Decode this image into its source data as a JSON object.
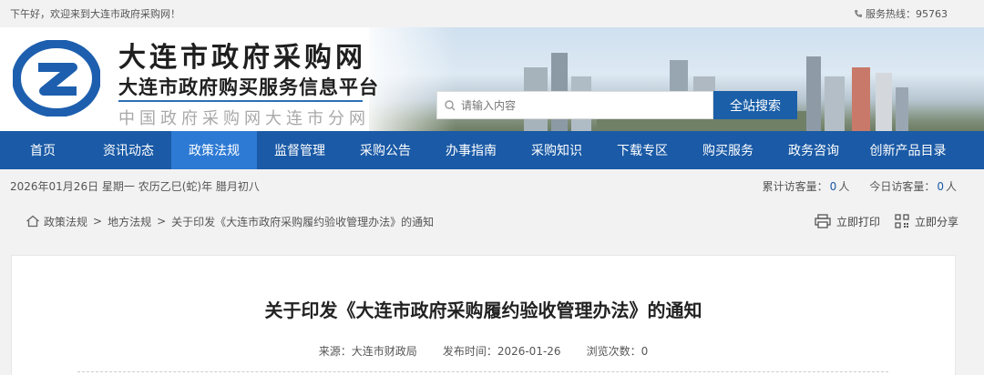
{
  "topbar": {
    "greeting": "下午好，欢迎来到大连市政府采购网！",
    "hotline": "服务热线：95763"
  },
  "header": {
    "title": "大连市政府采购网",
    "subtitle": "大连市政府购买服务信息平台",
    "tagline": "中国政府采购网大连市分网",
    "search_placeholder": "请输入内容",
    "search_button": "全站搜索"
  },
  "nav": {
    "items": [
      {
        "label": "首页"
      },
      {
        "label": "资讯动态"
      },
      {
        "label": "政策法规"
      },
      {
        "label": "监督管理"
      },
      {
        "label": "采购公告"
      },
      {
        "label": "办事指南"
      },
      {
        "label": "采购知识"
      },
      {
        "label": "下载专区"
      },
      {
        "label": "购买服务"
      },
      {
        "label": "政务咨询"
      },
      {
        "label": "创新产品目录"
      }
    ],
    "active": "政策法规"
  },
  "datebar": {
    "date": "2026年01月26日 星期一 农历乙巳(蛇)年 腊月初八",
    "total_label": "累计访客量：",
    "total_value": "0",
    "total_unit": "人",
    "today_label": "今日访客量：",
    "today_value": "0",
    "today_unit": "人"
  },
  "breadcrumb": {
    "items": [
      "政策法规",
      "地方法规",
      "关于印发《大连市政府采购履约验收管理办法》的通知"
    ],
    "separator": ">"
  },
  "actions": {
    "print": "立即打印",
    "share": "立即分享"
  },
  "article": {
    "title": "关于印发《大连市政府采购履约验收管理办法》的通知",
    "source": "来源：大连市财政局",
    "date": "发布时间：2026-01-26",
    "views": "浏览次数：0"
  },
  "colors": {
    "nav_bg": "#1a5aa6",
    "nav_active": "#2d7ad4",
    "accent": "#1b5fa8"
  }
}
